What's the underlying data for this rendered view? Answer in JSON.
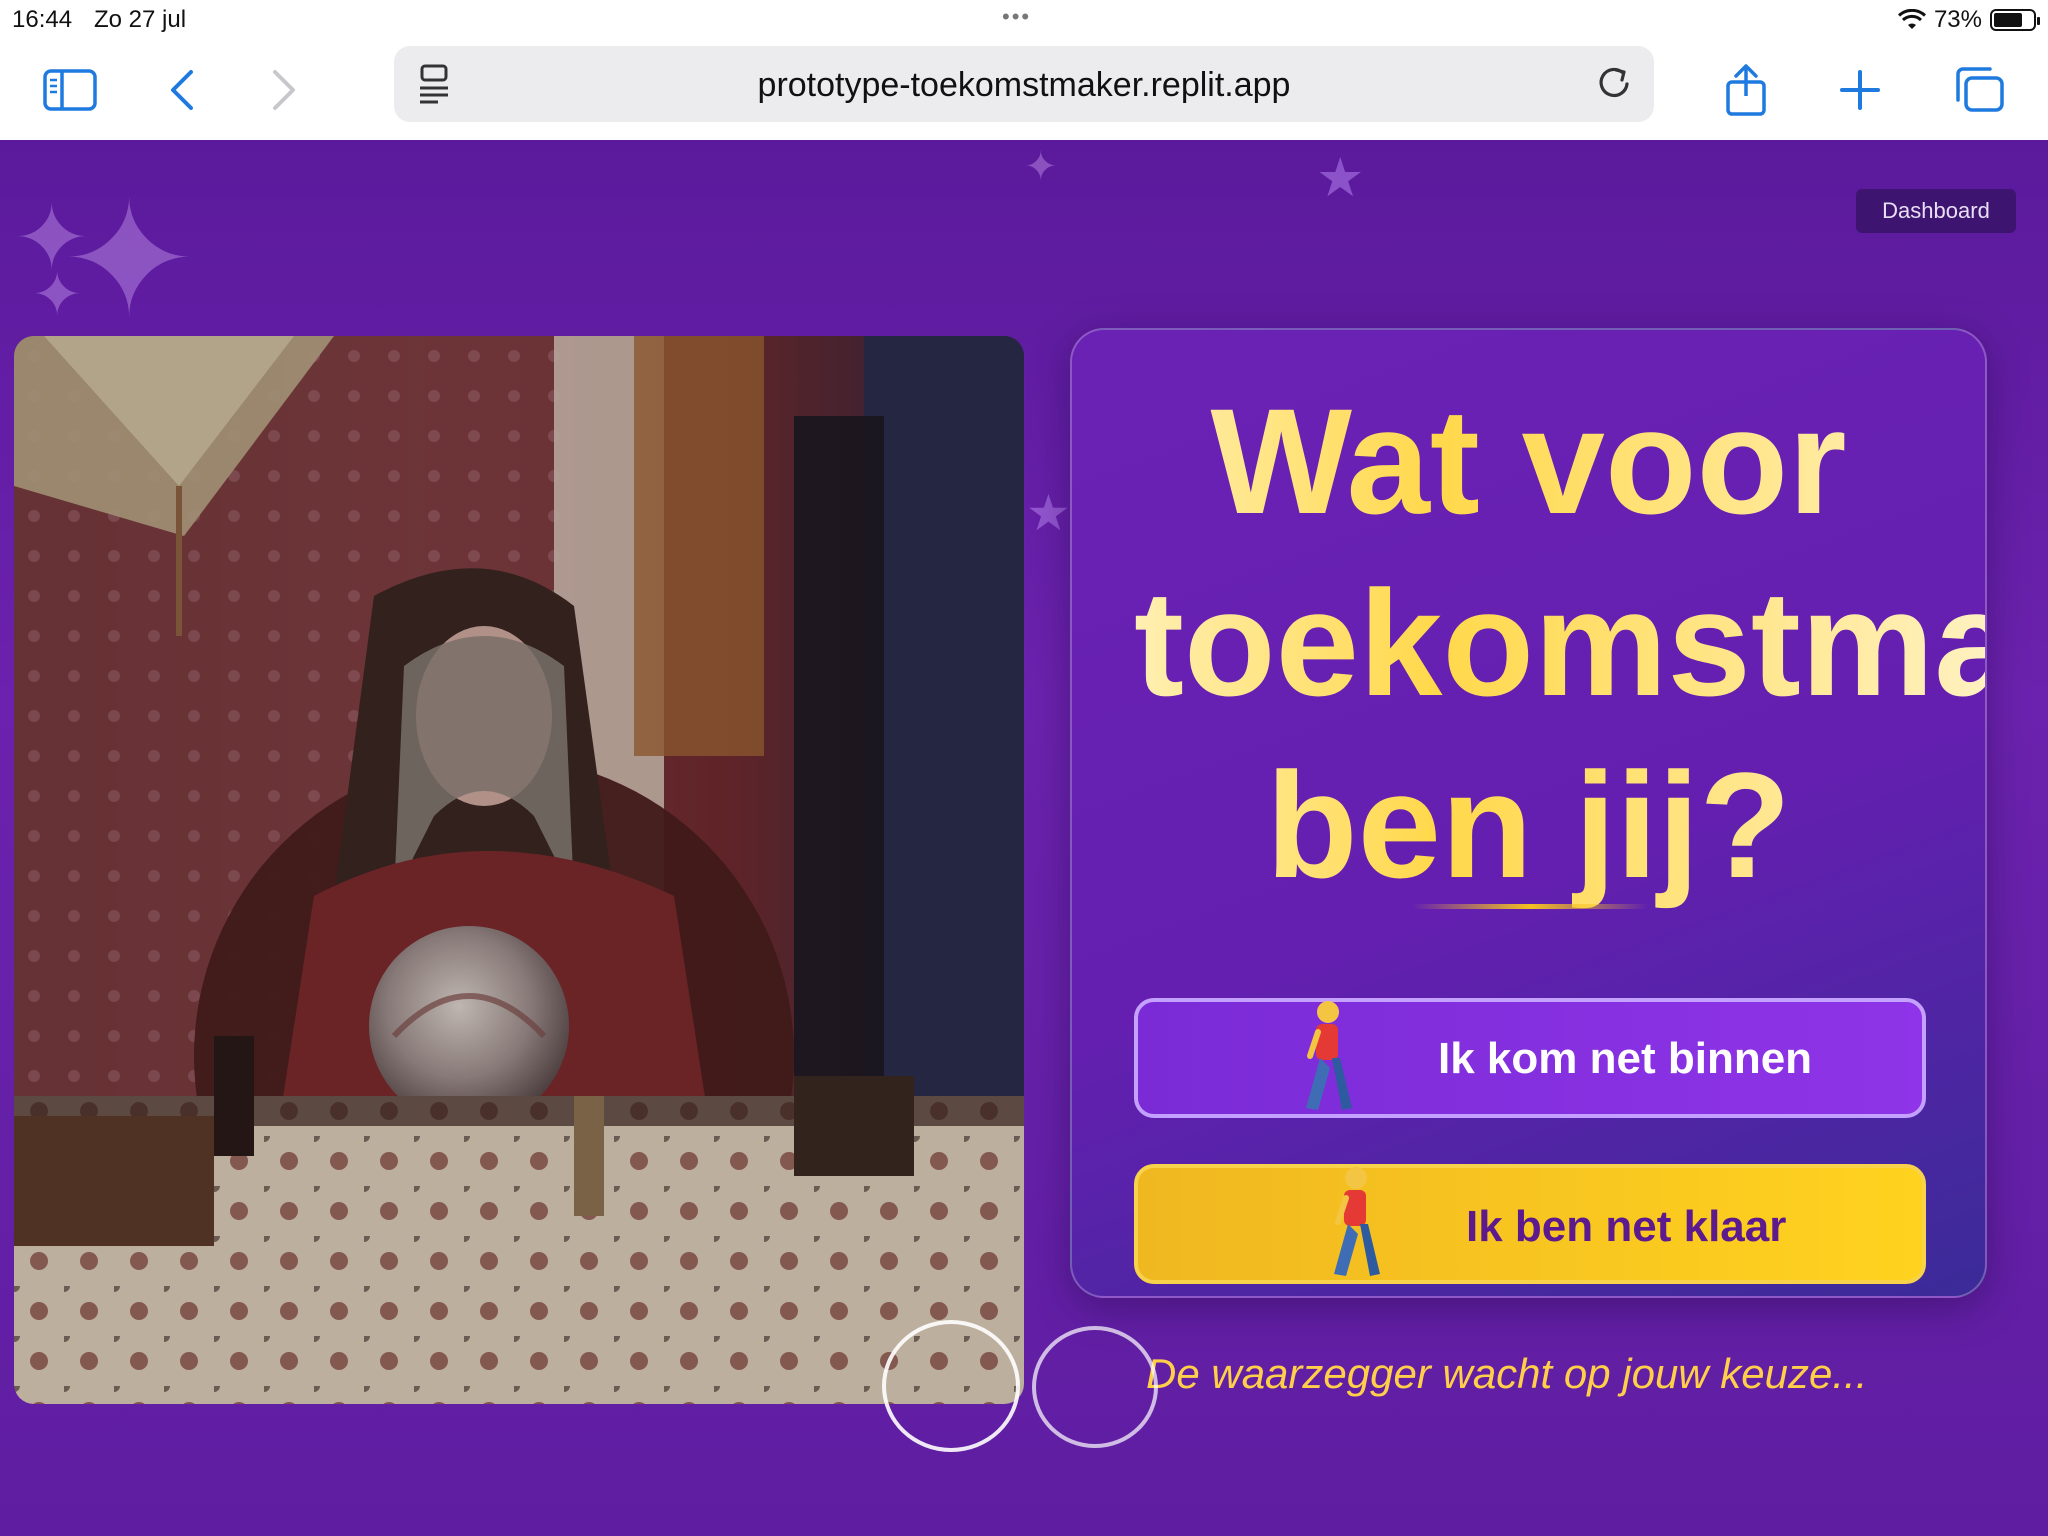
{
  "status_bar": {
    "time": "16:44",
    "date": "Zo 27 jul",
    "battery_percent": "73%",
    "battery_level": 0.73
  },
  "browser": {
    "url": "prototype-toekomstmaker.replit.app",
    "icons": [
      "sidebar-icon",
      "back-icon",
      "forward-icon",
      "reader-icon",
      "reload-icon",
      "share-icon",
      "new-tab-icon",
      "tabs-icon"
    ]
  },
  "page": {
    "dashboard_label": "Dashboard",
    "headline": {
      "line1": "Wat voor",
      "line2": "toekomstma",
      "line3": "ben jij?"
    },
    "buttons": [
      {
        "label": "Ik kom net binnen",
        "icon": "walking-person-icon"
      },
      {
        "label": "Ik ben net klaar",
        "icon": "walking-person-icon"
      }
    ],
    "tagline": "De waarzegger wacht op jouw keuze...",
    "colors": {
      "background": "#5d1a9e",
      "accent_yellow": "#ffd21f",
      "button_purple": "#8f34e8",
      "headline": "#ffe089"
    }
  }
}
